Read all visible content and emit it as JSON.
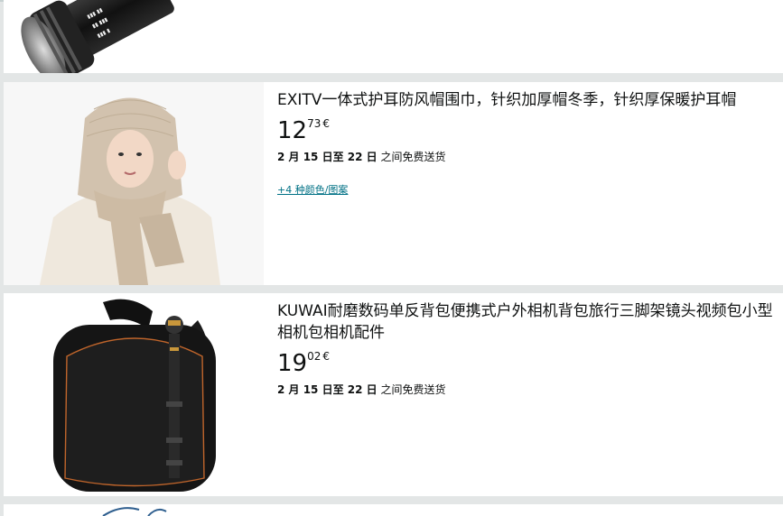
{
  "products": [
    {
      "title": "",
      "price_whole": "",
      "price_fraction": "",
      "currency": "",
      "delivery_prefix": "",
      "delivery_dates": "",
      "delivery_suffix": "",
      "variants_link": ""
    },
    {
      "title": "EXITV一体式护耳防风帽围巾，针织加厚帽冬季，针织厚保暖护耳帽",
      "price_whole": "12",
      "price_fraction": "73",
      "currency": "€",
      "delivery_dates": "2 月 15 日至 22 日",
      "delivery_suffix": "之间免费送货",
      "variants_link": "+4 种颜色/图案"
    },
    {
      "title": "KUWAI耐磨数码单反背包便携式户外相机背包旅行三脚架镜头视频包小型相机包相机配件",
      "price_whole": "19",
      "price_fraction": "02",
      "currency": "€",
      "delivery_dates": "2 月 15 日至 22 日",
      "delivery_suffix": "之间免费送货"
    }
  ],
  "colors": {
    "link": "#007185",
    "background": "#e3e6e6",
    "card": "#ffffff"
  }
}
